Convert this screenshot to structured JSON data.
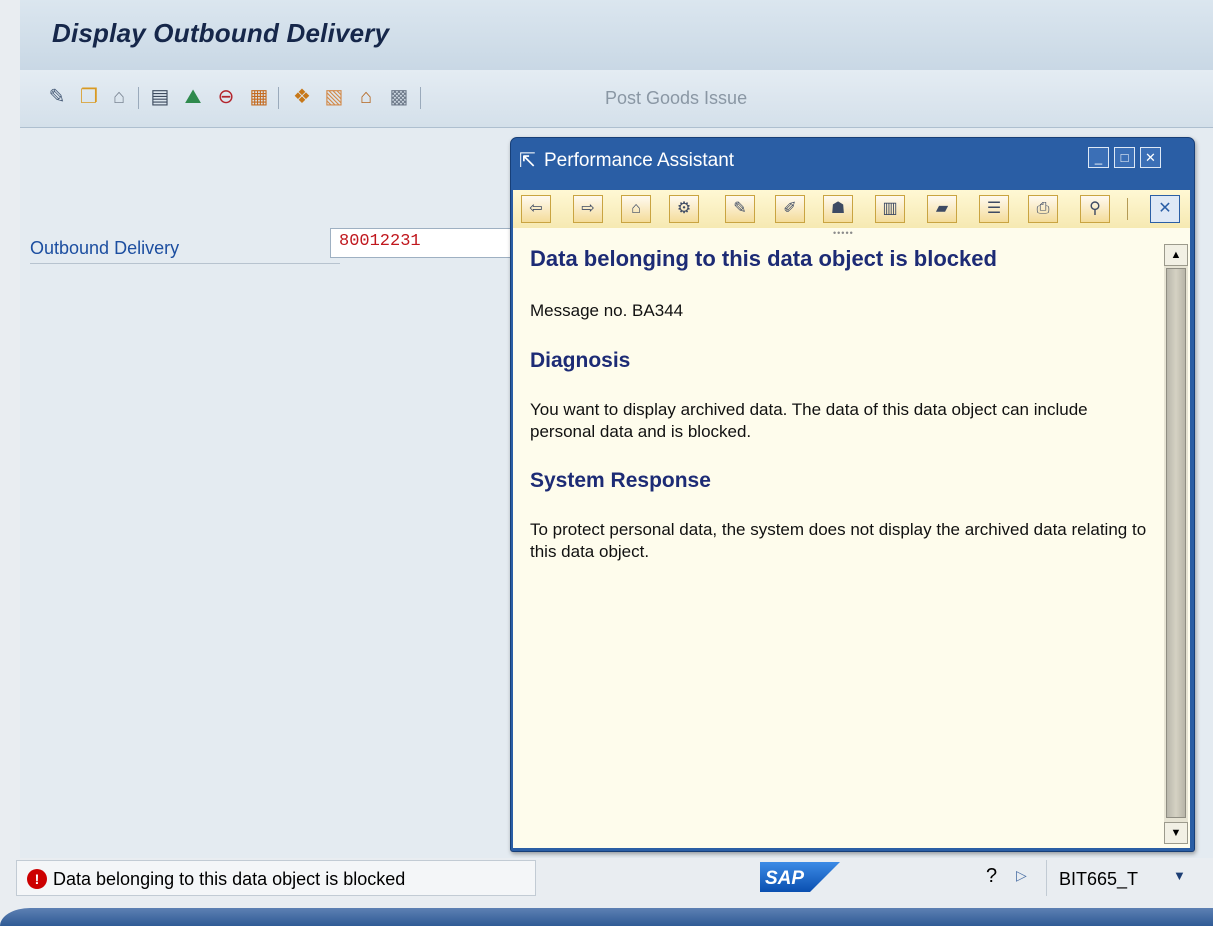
{
  "window": {
    "title": "Display Outbound Delivery"
  },
  "toolbar": {
    "icons": [
      "other-object-icon",
      "change-display-icon",
      "delete-icon",
      "header-details-icon",
      "partner-icon",
      "texts-icon",
      "dates-icon",
      "pack-icon",
      "picking-icon",
      "warehouse-icon",
      "overview-icon"
    ],
    "post_goods_issue_label": "Post Goods Issue"
  },
  "form": {
    "outbound_delivery_label": "Outbound Delivery",
    "outbound_delivery_value": "80012231"
  },
  "popup": {
    "title": "Performance Assistant",
    "window_controls": [
      "minimize",
      "maximize",
      "close"
    ],
    "toolbar_buttons": [
      "back",
      "forward",
      "home",
      "technical-info",
      "edit",
      "extended-help",
      "application-help",
      "glossary",
      "release-notes",
      "feedback",
      "print",
      "find",
      "close"
    ],
    "heading": "Data belonging to this data object is blocked",
    "message_no": "Message no. BA344",
    "sections": [
      {
        "title": "Diagnosis",
        "text": "You want to display archived data. The data of this data object can include personal data and is blocked."
      },
      {
        "title": "System Response",
        "text": "To protect personal data, the system does not display the archived data relating to this data object."
      }
    ]
  },
  "status_bar": {
    "message": "Data belonging to this data object is blocked",
    "message_type": "error",
    "logo_text": "SAP",
    "system": "BIT665_T"
  },
  "colors": {
    "popup_title_bg": "#2a5ea5",
    "heading_text": "#1d2b75",
    "field_label": "#1c4ea0",
    "field_value": "#c0171d",
    "error": "#cc0000"
  }
}
